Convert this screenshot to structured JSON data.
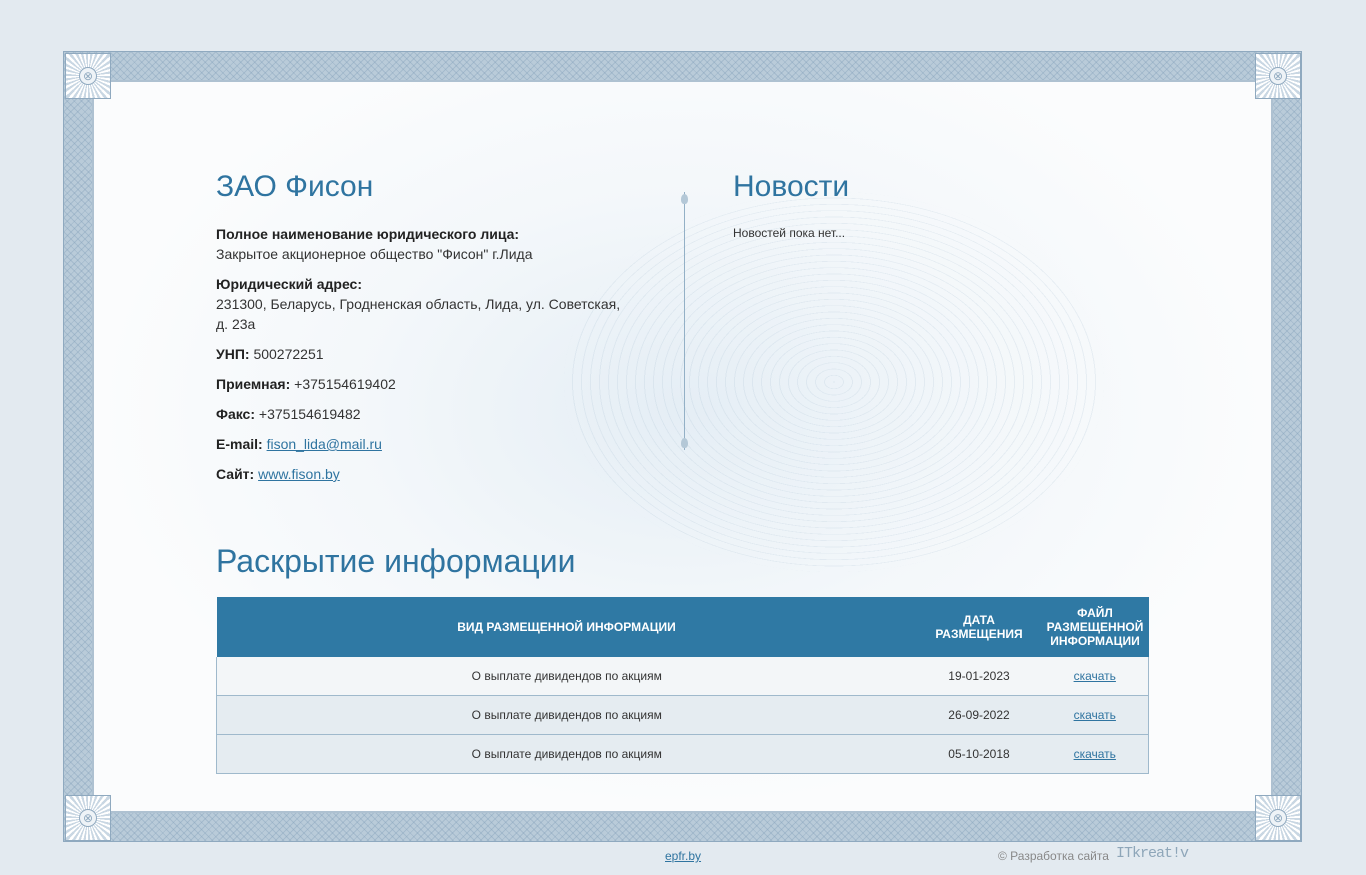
{
  "company": {
    "title": "ЗАО Фисон",
    "full_name_label": "Полное наименование юридического лица:",
    "full_name_value": "Закрытое акционерное общество \"Фисон\" г.Лида",
    "address_label": "Юридический адрес:",
    "address_value": "231300, Беларусь, Гродненская область, Лида, ул. Советская, д. 23а",
    "unp_label": "УНП:",
    "unp_value": "500272251",
    "reception_label": "Приемная:",
    "reception_value": "+375154619402",
    "fax_label": "Факс:",
    "fax_value": "+375154619482",
    "email_label": "E-mail:",
    "email_value": "fison_lida@mail.ru",
    "site_label": "Сайт:",
    "site_value": "www.fison.by"
  },
  "news": {
    "title": "Новости",
    "empty_text": "Новостей пока нет..."
  },
  "disclosure": {
    "title": "Раскрытие информации",
    "columns": [
      "Вид размещенной информации",
      "Дата размещения",
      "Файл размещенной информации"
    ],
    "rows": [
      {
        "type": "О выплате дивидендов по акциям",
        "date": "19-01-2023",
        "file": "скачать"
      },
      {
        "type": "О выплате дивидендов по акциям",
        "date": "26-09-2022",
        "file": "скачать"
      },
      {
        "type": "О выплате дивидендов по акциям",
        "date": "05-10-2018",
        "file": "скачать"
      }
    ]
  },
  "footer": {
    "link": "epfr.by",
    "dev_text": "© Разработка сайта",
    "dev_logo": "ITkreat!v"
  },
  "colors": {
    "accent": "#2f74a0",
    "table_header": "#2f79a4",
    "background": "#e3eaf0"
  },
  "icons": {
    "frame_corners": "rosette-ornament-icon"
  }
}
